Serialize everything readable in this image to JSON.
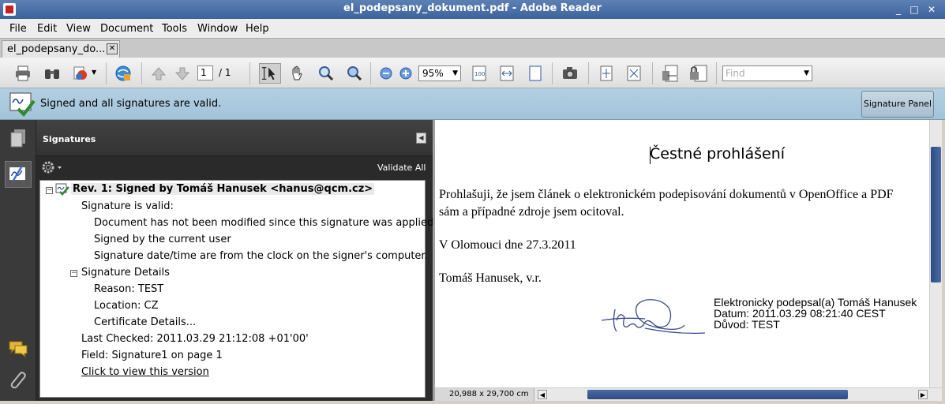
{
  "window": {
    "title": "el_podepsany_dokument.pdf - Adobe Reader",
    "minimize": "_",
    "maximize": "□",
    "close": "✕"
  },
  "menu": [
    "File",
    "Edit",
    "View",
    "Document",
    "Tools",
    "Window",
    "Help"
  ],
  "tab": {
    "label": "el_podepsany_do...",
    "close": "✕"
  },
  "toolbar": {
    "page_current": "1",
    "page_total": "/  1",
    "zoom": "95%",
    "find_placeholder": "Find",
    "icons": [
      "print-icon",
      "search-binoculars-icon",
      "create-pdf-icon",
      "collaborate-icon",
      "previous-page-icon",
      "next-page-icon",
      "select-tool-icon",
      "hand-tool-icon",
      "marquee-zoom-icon",
      "dynamic-zoom-icon",
      "zoom-out-icon",
      "zoom-in-icon",
      "actual-size-icon",
      "fit-width-icon",
      "fit-page-icon",
      "snapshot-icon",
      "scrolling-mode-icon",
      "full-screen-icon",
      "sign-icon",
      "signature-lock-icon"
    ]
  },
  "message_bar": {
    "message": "Signed and all signatures are valid.",
    "button": "Signature Panel"
  },
  "signatures_panel": {
    "title": "Signatures",
    "validate_all": "Validate All",
    "tree": {
      "revision": "Rev. 1: Signed by Tomáš Hanusek <hanus@qcm.cz>",
      "valid_header": "Signature is valid:",
      "valid_items": [
        "Document has not been modified since this signature was applied",
        "Signed by the current user",
        "Signature date/time are from the clock on the signer's computer."
      ],
      "details_header": "Signature Details",
      "details_items": [
        "Reason: TEST",
        "Location: CZ",
        "Certificate Details..."
      ],
      "last_checked": "Last Checked: 2011.03.29 21:12:08 +01'00'",
      "field": "Field: Signature1 on page 1",
      "view_version": "Click to view this version"
    }
  },
  "document": {
    "title": "Čestné prohlášení",
    "para_line1": "Prohlašuji, že jsem článek o elektronickém podepisování dokumentů v OpenOffice a PDF",
    "para_line2": "sám a případné zdroje jsem ocitoval.",
    "place_date": "V Olomouci dne 27.3.2011",
    "signer": "Tomáš Hanusek, v.r.",
    "sig_line1": "Elektronicky podepsal(a) Tomáš Hanusek",
    "sig_line2": "Datum: 2011.03.29 08:21:40 CEST",
    "sig_line3": "Důvod: TEST",
    "page_size": "20,988 x 29,700 cm"
  },
  "colors": {
    "titlebar": "#4a6ea8",
    "message_bar": "#aecadf",
    "panel_dark": "#2c2c2c",
    "scroll_thumb": "#3a5a94"
  }
}
